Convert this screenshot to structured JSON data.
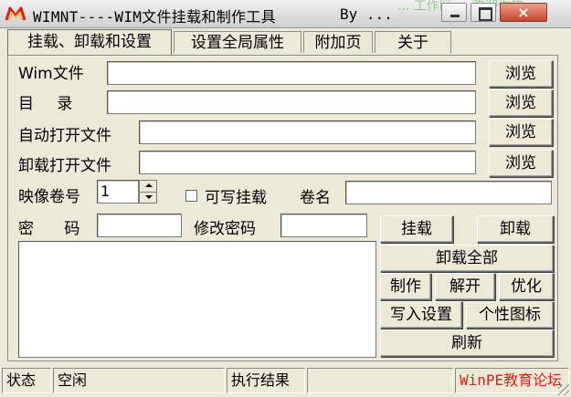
{
  "window": {
    "title": "WIMNT----WIM文件挂载和制作工具",
    "title_suffix": "By ...",
    "title_overlay": "... 工作区 ... 欢迎你的 ...",
    "close_glyph": "×"
  },
  "tabs": [
    {
      "label": "挂载、卸载和设置",
      "active": true
    },
    {
      "label": "设置全局属性",
      "active": false
    },
    {
      "label": "附加页",
      "active": false
    },
    {
      "label": "关于",
      "active": false
    }
  ],
  "form": {
    "wim_file": {
      "label": "Wim文件",
      "value": "",
      "browse": "浏览"
    },
    "directory": {
      "label": "目  录",
      "value": "",
      "browse": "浏览"
    },
    "auto_open": {
      "label": "自动打开文件",
      "value": "",
      "browse": "浏览"
    },
    "unmount_open": {
      "label": "卸载打开文件",
      "value": "",
      "browse": "浏览"
    },
    "image_index": {
      "label": "映像卷号",
      "value": "1"
    },
    "writable_mount": {
      "label": "可写挂载",
      "checked": false
    },
    "volume_name": {
      "label": "卷名",
      "value": ""
    },
    "password": {
      "label": "密  码",
      "value": ""
    },
    "change_password": {
      "label": "修改密码",
      "value": ""
    }
  },
  "actions": {
    "mount": "挂载",
    "unmount": "卸载",
    "unmount_all": "卸载全部",
    "make": "制作",
    "extract": "解开",
    "optimize": "优化",
    "write_settings": "写入设置",
    "custom_icon": "个性图标",
    "refresh": "刷新"
  },
  "status": {
    "state_label": "状态",
    "state_value": "空闲",
    "result_label": "执行结果",
    "result_value": "",
    "brand": "WinPE教育论坛"
  },
  "colors": {
    "brand_red": "#e0201a",
    "face": "#ece9d8"
  }
}
